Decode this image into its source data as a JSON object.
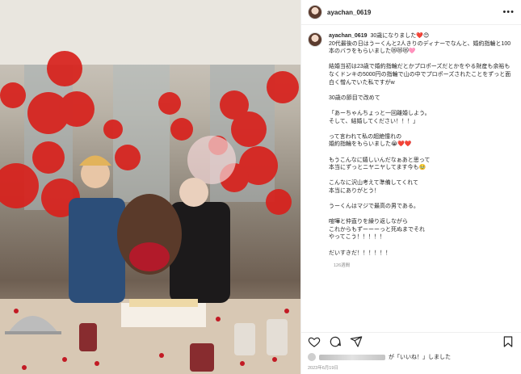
{
  "post": {
    "username": "ayachan_0619",
    "more_label": "•••",
    "first_line": "30歳になりました❤️😊",
    "caption": "20代最後の日はうーくんと2人きりのディナーでなんと、婚約指輪と100本のバラをもらいました😻😻😻🩷\n\n結婚当初は23歳で婚約指輪だとかプロポーズだとかをやる財産も余裕もなくドンキの5000円の指輪で山の中でプロポーズされたことをずっと面白く憎んでいた私ですがw\n\n30歳の節目で改めて\n\n「あーちゃんちょっと一回離婚しよう。\nそして、結婚してください！！！」\n\nって言われて私の超絶憧れの\n婚約指輪をもらいました😭❤️❤️\n\nもうこんなに嬉しいんだなぁあと思って\n本当にずっとニヤニヤしてます今も🥹\n\nこんなに沢山考えて準備してくれて\n本当にありがとう！\n\nうーくんはマジで最高の男である。\n\n喧嘩と仲直りを繰り返しながら\nこれからもずーーーっと死ぬまでそれ\nやってこう！！！！！\n\nだいすきだ！！！！！！",
    "time_ago": "126週間",
    "likes_text": "が「いいね！」しました",
    "date": "2023年6月19日"
  },
  "icons": [
    "heart-icon",
    "comment-icon",
    "share-icon",
    "bookmark-icon"
  ]
}
